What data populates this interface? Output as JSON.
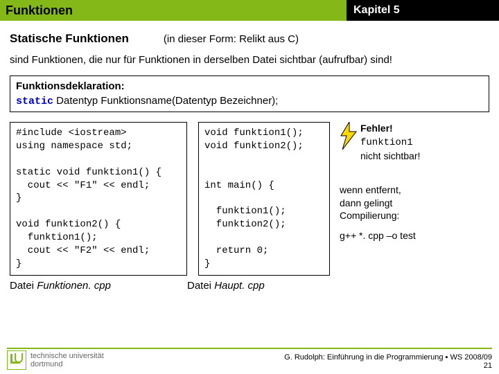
{
  "header": {
    "title": "Funktionen",
    "chapter": "Kapitel 5"
  },
  "sub": {
    "title": "Statische Funktionen",
    "note": "(in dieser Form: Relikt aus C)"
  },
  "body": "sind Funktionen, die nur für Funktionen in derselben Datei sichtbar (aufrufbar) sind!",
  "decl": {
    "title": "Funktionsdeklaration:",
    "kw": "static",
    "rest": " Datentyp Funktionsname(Datentyp Bezeichner);"
  },
  "code1": "#include <iostream>\nusing namespace std;\n\nstatic void funktion1() {\n  cout << \"F1\" << endl;\n}\n\nvoid funktion2() {\n  funktion1();\n  cout << \"F2\" << endl;\n}",
  "caption1a": "Datei ",
  "caption1b": "Funktionen. cpp",
  "code2": "void funktion1();\nvoid funktion2();\n\n\nint main() {\n\n  funktion1();\n  funktion2();\n\n  return 0;\n}",
  "caption2a": "Datei ",
  "caption2b": "Haupt. cpp",
  "right": {
    "err_label": "Fehler!",
    "err_fn": "funktion1",
    "err_rest": "nicht sichtbar!",
    "l1": "wenn entfernt,",
    "l2": "dann gelingt",
    "l3": "Compilierung:",
    "cmd": "g++ *. cpp –o test"
  },
  "footer": {
    "line": "G. Rudolph: Einführung in die Programmierung ▪ WS 2008/09",
    "page": "21"
  },
  "logo": {
    "l1": "technische universität",
    "l2": "dortmund"
  }
}
